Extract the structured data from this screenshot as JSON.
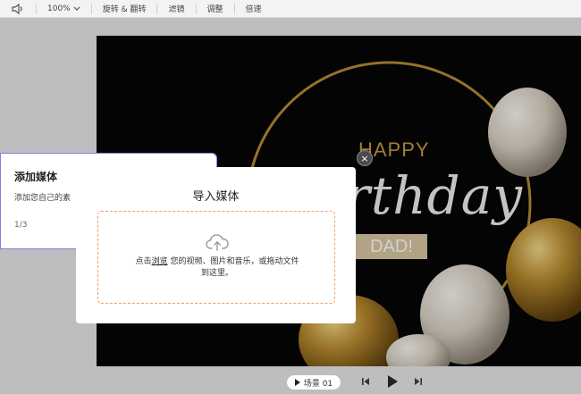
{
  "toolbar": {
    "zoom": "100%",
    "rotate_flip": "旋转 & 翻转",
    "filter": "滤镜",
    "adjust": "调整",
    "speed": "倍速"
  },
  "canvas": {
    "happy": "HAPPY",
    "birthday": "Birthday",
    "dad": "DAD!"
  },
  "tip_card": {
    "title": "添加媒体",
    "desc": "添加您自己的素",
    "count": "1/3"
  },
  "modal": {
    "title": "导入媒体",
    "text_prefix": "点击",
    "browse_link": "浏览",
    "text_suffix": " 您的视频、图片和音乐，或拖动文件",
    "text_line2": "到这里。",
    "close": "×"
  },
  "bottom": {
    "scene_label": "场景 01"
  },
  "colors": {
    "accent_purple": "#8d7ae0",
    "dashed_orange": "#f0a06a",
    "gold": "#c59a3e"
  },
  "icons": [
    "speaker-icon",
    "chevron-down-icon",
    "upload-cloud-icon",
    "close-icon",
    "play-icon",
    "skip-back-icon",
    "skip-forward-icon"
  ]
}
